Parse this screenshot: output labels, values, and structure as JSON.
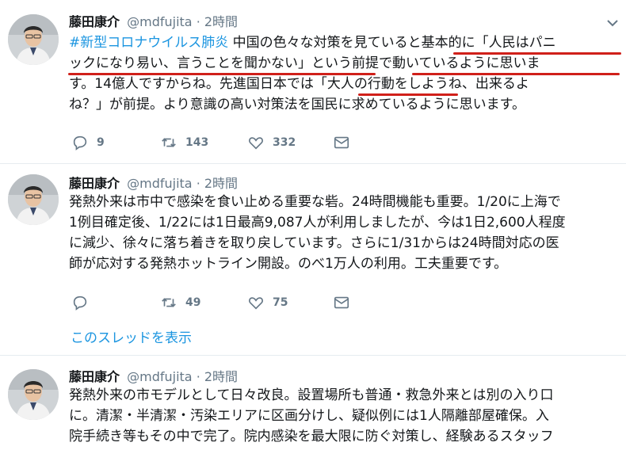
{
  "tweets": [
    {
      "name": "藤田康介",
      "handle": "@mdfujita",
      "sep": "·",
      "time": "2時間",
      "hashtag": "#新型コロナウイルス肺炎",
      "text_after_hashtag": " 中国の色々な対策を見ていると基本的に「人民はパニ",
      "lines": [
        "ックになり易い、言うことを聞かない」という前提で動いているように思いま",
        "す。14億人ですからね。先進国日本では「大人の行動をしようね、出来るよ",
        "ね？」が前提。より意識の高い対策法を国民に求めているように思います。"
      ],
      "reply_count": "9",
      "retweet_count": "143",
      "like_count": "332"
    },
    {
      "name": "藤田康介",
      "handle": "@mdfujita",
      "sep": "·",
      "time": "2時間",
      "lines": [
        "発熱外来は市中で感染を食い止める重要な砦。24時間機能も重要。1/20に上海で",
        "1例目確定後、1/22には1日最高9,087人が利用しましたが、今は1日2,600人程度",
        "に減少、徐々に落ち着きを取り戻しています。さらに1/31からは24時間対応の医",
        "師が応対する発熱ホットライン開設。のべ1万人の利用。工夫重要です。"
      ],
      "reply_count": "",
      "retweet_count": "49",
      "like_count": "75",
      "thread_link": "このスレッドを表示"
    },
    {
      "name": "藤田康介",
      "handle": "@mdfujita",
      "sep": "·",
      "time": "2時間",
      "lines": [
        "発熱外来の市モデルとして日々改良。設置場所も普通・救急外来とは別の入り口",
        "に。清潔・半清潔・汚染エリアに区画分けし、疑似例には1人隔離部屋確保。入",
        "院手続き等もその中で完了。院内感染を最大限に防ぐ対策し、経験あるスタッフ"
      ]
    }
  ],
  "colors": {
    "text": "#14171a",
    "secondary": "#657786",
    "link": "#1b95e0",
    "annotation": "#d0201a",
    "divider": "#e6ecf0"
  },
  "icons": [
    "avatar",
    "chevron-down-icon",
    "reply-icon",
    "retweet-icon",
    "like-icon",
    "dm-icon"
  ]
}
